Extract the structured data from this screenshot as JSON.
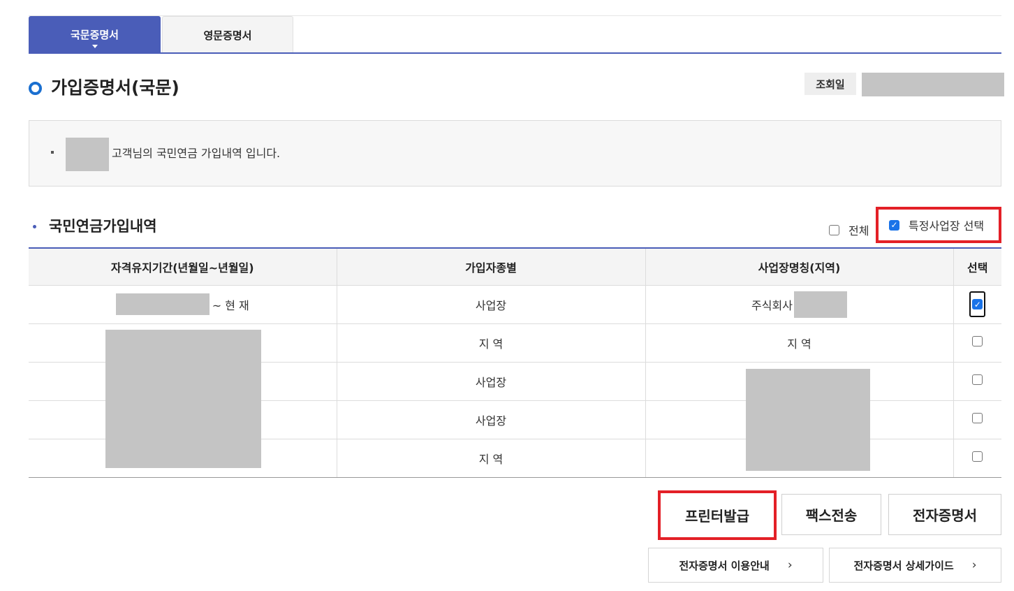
{
  "tabs": [
    {
      "label": "국문증명서",
      "active": true
    },
    {
      "label": "영문증명서",
      "active": false
    }
  ],
  "page_title": "가입증명서(국문)",
  "inquiry_date_label": "조회일",
  "info_text": "고객님의 국민연금 가입내역 입니다.",
  "section_title": "국민연금가입내역",
  "filters": {
    "all_label": "전체",
    "all_checked": false,
    "specific_label": "특정사업장 선택",
    "specific_checked": true
  },
  "table": {
    "headers": [
      "자격유지기간(년월일~년월일)",
      "가입자종별",
      "사업장명칭(지역)",
      "선택"
    ],
    "rows": [
      {
        "period_suffix": "~ 현 재",
        "type": "사업장",
        "name_prefix": "주식회사",
        "checked": true
      },
      {
        "type": "지 역",
        "name": "지 역",
        "checked": false
      },
      {
        "type": "사업장",
        "checked": false
      },
      {
        "type": "사업장",
        "checked": false
      },
      {
        "type": "지 역",
        "checked": false
      }
    ]
  },
  "buttons": {
    "print": "프린터발급",
    "fax": "팩스전송",
    "ecert": "전자증명서"
  },
  "links": {
    "guide": "전자증명서 이용안내",
    "detail": "전자증명서 상세가이드"
  },
  "colors": {
    "primary": "#4a5db8",
    "highlight": "#e32027",
    "checkbox": "#1a73e8",
    "mask": "#c4c4c4"
  }
}
